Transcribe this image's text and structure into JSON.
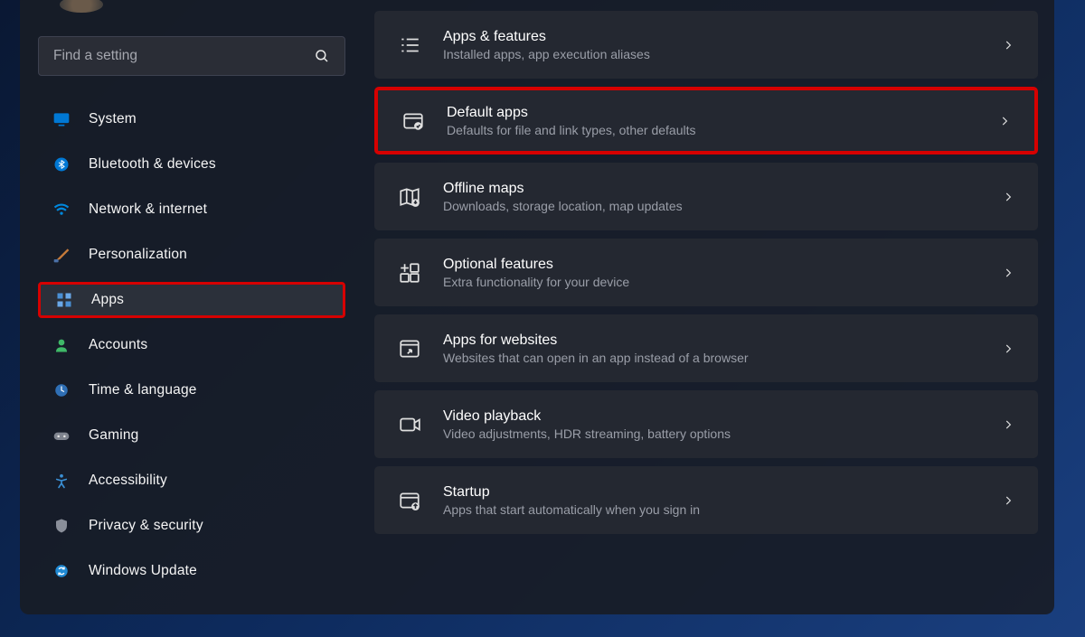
{
  "search": {
    "placeholder": "Find a setting"
  },
  "sidebar": {
    "items": [
      {
        "id": "system",
        "label": "System"
      },
      {
        "id": "bluetooth",
        "label": "Bluetooth & devices"
      },
      {
        "id": "network",
        "label": "Network & internet"
      },
      {
        "id": "personalization",
        "label": "Personalization"
      },
      {
        "id": "apps",
        "label": "Apps"
      },
      {
        "id": "accounts",
        "label": "Accounts"
      },
      {
        "id": "time",
        "label": "Time & language"
      },
      {
        "id": "gaming",
        "label": "Gaming"
      },
      {
        "id": "accessibility",
        "label": "Accessibility"
      },
      {
        "id": "privacy",
        "label": "Privacy & security"
      },
      {
        "id": "update",
        "label": "Windows Update"
      }
    ]
  },
  "cards": [
    {
      "id": "appsfeatures",
      "title": "Apps & features",
      "desc": "Installed apps, app execution aliases"
    },
    {
      "id": "defaultapps",
      "title": "Default apps",
      "desc": "Defaults for file and link types, other defaults"
    },
    {
      "id": "offlinemaps",
      "title": "Offline maps",
      "desc": "Downloads, storage location, map updates"
    },
    {
      "id": "optionalfeatures",
      "title": "Optional features",
      "desc": "Extra functionality for your device"
    },
    {
      "id": "appsforwebsites",
      "title": "Apps for websites",
      "desc": "Websites that can open in an app instead of a browser"
    },
    {
      "id": "videoplayback",
      "title": "Video playback",
      "desc": "Video adjustments, HDR streaming, battery options"
    },
    {
      "id": "startup",
      "title": "Startup",
      "desc": "Apps that start automatically when you sign in"
    }
  ]
}
